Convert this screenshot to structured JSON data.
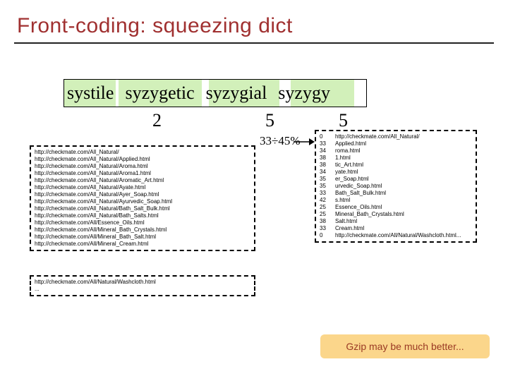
{
  "title": "Front-coding: squeezing dict",
  "words": {
    "w1": "systile",
    "w2": "syzygetic",
    "w3": "syzygial",
    "w4": "syzygy"
  },
  "nums": {
    "n2": "2",
    "n5a": "5",
    "n5b": "5"
  },
  "ratio": "33÷45%",
  "left_urls": [
    "http://checkmate.com/All_Natural/",
    "http://checkmate.com/All_Natural/Applied.html",
    "http://checkmate.com/All_Natural/Aroma.html",
    "http://checkmate.com/All_Natural/Aroma1.html",
    "http://checkmate.com/All_Natural/Aromatic_Art.html",
    "http://checkmate.com/All_Natural/Ayate.html",
    "http://checkmate.com/All_Natural/Ayer_Soap.html",
    "http://checkmate.com/All_Natural/Ayurvedic_Soap.html",
    "http://checkmate.com/All_Natural/Bath_Salt_Bulk.html",
    "http://checkmate.com/All_Natural/Bath_Salts.html",
    "http://checkmate.com/All/Essence_Oils.html",
    "http://checkmate.com/All/Mineral_Bath_Crystals.html",
    "http://checkmate.com/All/Mineral_Bath_Salt.html",
    "http://checkmate.com/All/Mineral_Cream.html"
  ],
  "bottom_urls": [
    "http://checkmate.com/All/Natural/Washcloth.html",
    "..."
  ],
  "right_rows": [
    {
      "off": "0",
      "url": "http://checkmate.com/All_Natural/"
    },
    {
      "off": "33",
      "url": "Applied.html"
    },
    {
      "off": "34",
      "url": "roma.html"
    },
    {
      "off": "38",
      "url": "1.html"
    },
    {
      "off": "38",
      "url": "tic_Art.html"
    },
    {
      "off": "34",
      "url": "yate.html"
    },
    {
      "off": "35",
      "url": "er_Soap.html"
    },
    {
      "off": "35",
      "url": "urvedic_Soap.html"
    },
    {
      "off": "33",
      "url": "Bath_Salt_Bulk.html"
    },
    {
      "off": "42",
      "url": "s.html"
    },
    {
      "off": "25",
      "url": "Essence_Oils.html"
    },
    {
      "off": "25",
      "url": "Mineral_Bath_Crystals.html"
    },
    {
      "off": "38",
      "url": "Salt.html"
    },
    {
      "off": "33",
      "url": "Cream.html"
    },
    {
      "off": "",
      "url": ""
    },
    {
      "off": "0",
      "url": "http://checkmate.com/All/Natural/Washcloth.html..."
    }
  ],
  "badge": "Gzip may be much better..."
}
